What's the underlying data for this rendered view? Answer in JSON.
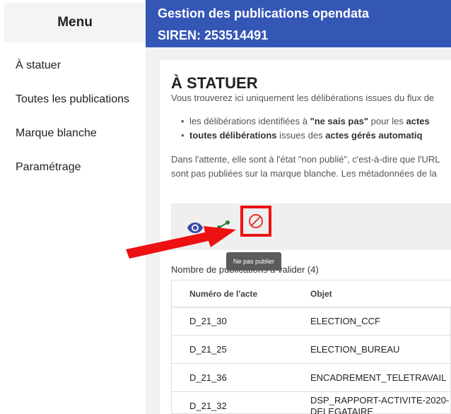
{
  "sidebar": {
    "title": "Menu",
    "items": [
      {
        "label": "À statuer"
      },
      {
        "label": "Toutes les publications"
      },
      {
        "label": "Marque blanche"
      },
      {
        "label": "Paramétrage"
      }
    ]
  },
  "header": {
    "title": "Gestion des publications opendata",
    "siren": "SIREN: 253514491",
    "background": "#3456b5"
  },
  "page": {
    "title": "À STATUER",
    "intro": "Vous trouverez ici uniquement les délibérations issues du flux de",
    "bullets": [
      {
        "pre": "les délibérations identifiées à ",
        "bold1": "\"ne sais pas\"",
        "mid": " pour les ",
        "bold2": "actes"
      },
      {
        "pre": "",
        "bold1": "toutes délibérations",
        "mid": " issues des ",
        "bold2": "actes gérés automatiq"
      }
    ],
    "para_line1": "Dans l'attente, elle sont à l'état \"non publié\", c'est-à-dire que l'URL",
    "para_line2": "sont pas publiées sur la marque blanche. Les métadonnées de la"
  },
  "toolbar": {
    "view_icon": "eye-icon",
    "share_icon": "share-icon",
    "block_icon": "block-icon",
    "view_color": "#3949ab",
    "share_color": "#2e7d32",
    "block_color": "#e53935",
    "tooltip": "Ne pas publier"
  },
  "count_label": "Nombre de publications à valider (4)",
  "table": {
    "headers": [
      "Numéro de l'acte",
      "Objet"
    ],
    "rows": [
      {
        "numero": "D_21_30",
        "objet": [
          "ELECTION_CCF"
        ]
      },
      {
        "numero": "D_21_25",
        "objet": [
          "ELECTION_BUREAU"
        ]
      },
      {
        "numero": "D_21_36",
        "objet": [
          "ENCADREMENT_TELETRAVAIL"
        ]
      },
      {
        "numero": "D_21_32",
        "objet": [
          "DSP_RAPPORT-ACTIVITE-2020-",
          "DELEGATAIRE"
        ]
      }
    ]
  },
  "annotation": {
    "arrow_color": "#ee1111"
  }
}
